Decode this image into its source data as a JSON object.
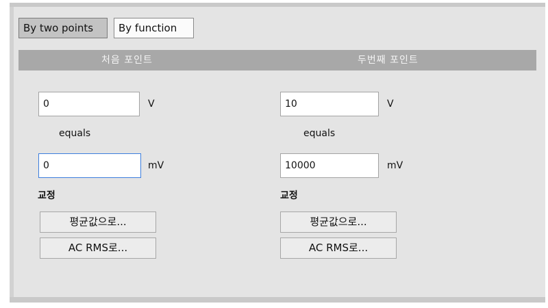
{
  "tabs": [
    {
      "label": "By two points",
      "active": true
    },
    {
      "label": "By function",
      "active": false
    }
  ],
  "header": {
    "first_point": "처음 포인트",
    "second_point": "두번째 포인트"
  },
  "first_point": {
    "v_value": "0",
    "v_unit": "V",
    "equals": "equals",
    "mv_value": "0",
    "mv_unit": "mV",
    "calibration_label": "교정",
    "avg_button": "평균값으로...",
    "rms_button": "AC RMS로..."
  },
  "second_point": {
    "v_value": "10",
    "v_unit": "V",
    "equals": "equals",
    "mv_value": "10000",
    "mv_unit": "mV",
    "calibration_label": "교정",
    "avg_button": "평균값으로...",
    "rms_button": "AC RMS로..."
  },
  "colors": {
    "panel_bg": "#e4e4e4",
    "header_bar": "#a8a8a8",
    "focus_border": "#3b7ddd"
  }
}
